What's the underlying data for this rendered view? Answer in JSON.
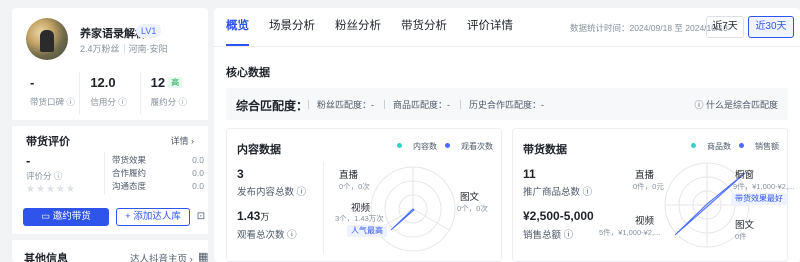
{
  "profile": {
    "name": "养家语录解析",
    "level": "LV1",
    "fans": "2.4万粉丝",
    "location": "河南·安阳",
    "stats": [
      {
        "value": "-",
        "label": "带货口碑"
      },
      {
        "value": "12.0",
        "label": "信用分"
      },
      {
        "value": "12",
        "label": "履约分",
        "badge": "高"
      }
    ]
  },
  "evaluation": {
    "title": "带货评价",
    "more": "详情",
    "score": "-",
    "score_label": "评价分",
    "rows": [
      {
        "label": "带货效果",
        "value": "0.0"
      },
      {
        "label": "合作履约",
        "value": "0.0"
      },
      {
        "label": "沟通态度",
        "value": "0.0"
      }
    ]
  },
  "actions": {
    "invite": "邀约带货",
    "add": "+ 添加达人库"
  },
  "other": {
    "title": "其他信息",
    "link": "达人抖音主页"
  },
  "tabs": [
    "概览",
    "场景分析",
    "粉丝分析",
    "带货分析",
    "评价详情"
  ],
  "active_tab": 0,
  "date_range": "数据统计时间：2024/09/18 至 2024/10/18",
  "range_buttons": {
    "seven": "近7天",
    "thirty": "近30天"
  },
  "core": {
    "title": "核心数据",
    "match_label": "综合匹配度：",
    "match_items": [
      "粉丝匹配度：-",
      "商品匹配度：-",
      "历史合作匹配度：-"
    ],
    "match_help": "什么是综合匹配度"
  },
  "content_card": {
    "title": "内容数据",
    "legend": [
      "内容数",
      "观看次数"
    ],
    "metrics": [
      {
        "value": "3",
        "unit": "",
        "label": "发布内容总数"
      },
      {
        "value": "1.43",
        "unit": "万",
        "label": "观看总次数"
      }
    ],
    "radar": {
      "top": {
        "label": "直播",
        "sub": "0个，0次"
      },
      "right": {
        "label": "图文",
        "sub": "0个，0次"
      },
      "left": {
        "label": "视频",
        "sub": "3个，1.43万次",
        "tag": "人气最高"
      }
    }
  },
  "sales_card": {
    "title": "带货数据",
    "legend": [
      "商品数",
      "销售额"
    ],
    "metrics": [
      {
        "value": "11",
        "unit": "",
        "label": "推广商品总数"
      },
      {
        "value": "¥2,500-5,000",
        "unit": "",
        "label": "销售总额"
      }
    ],
    "radar": {
      "top": {
        "label": "直播",
        "sub": "0件，0元"
      },
      "right": {
        "label": "橱窗",
        "sub": "9件，¥1,000-¥2,...",
        "tag": "带货效果最好"
      },
      "left": {
        "label": "视频",
        "sub": "5件，¥1,000-¥2,..."
      },
      "bottom_right": {
        "label": "图文",
        "sub": "0件"
      }
    }
  },
  "colors": {
    "accent": "#2f54eb",
    "series1": "#36cfc9",
    "series2": "#4b6aff",
    "good": "#12a150"
  }
}
